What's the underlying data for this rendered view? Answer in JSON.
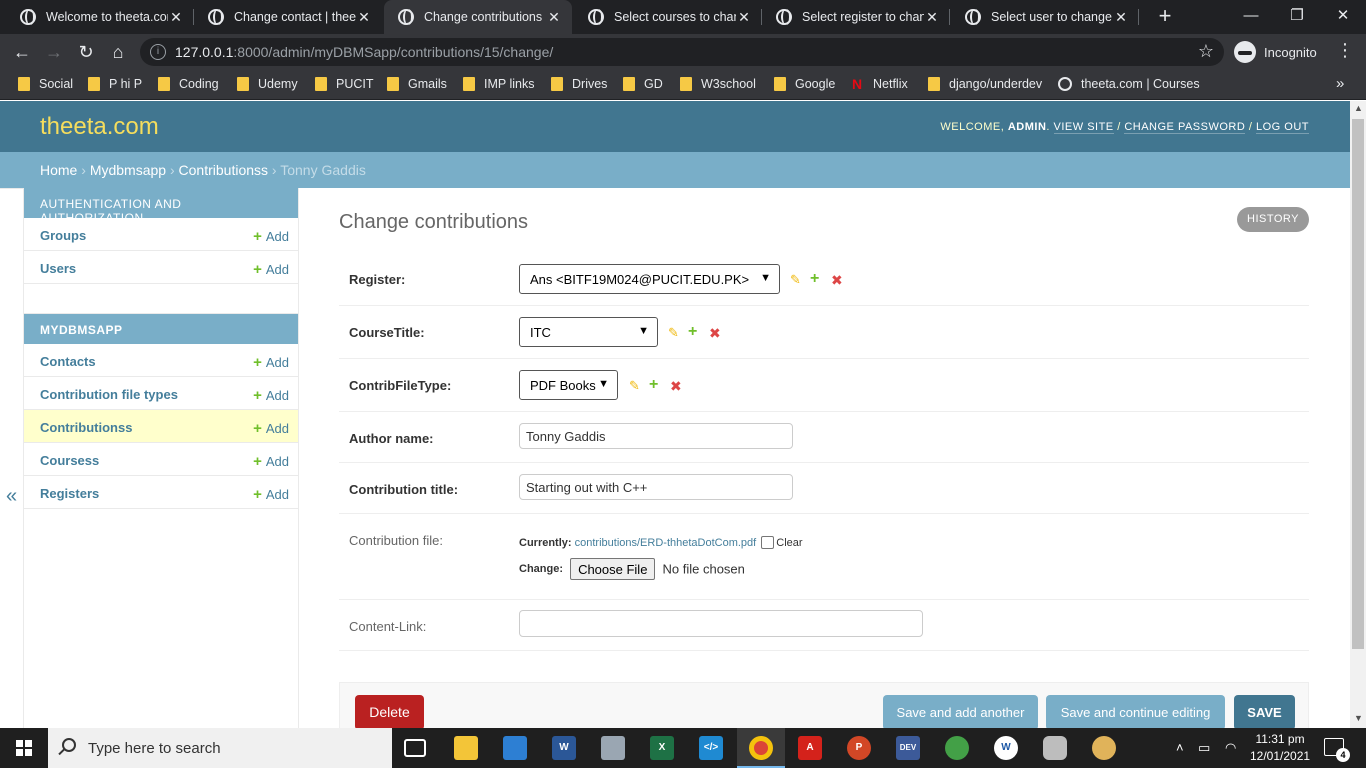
{
  "browser": {
    "tabs": [
      {
        "title": "Welcome to theeta.com"
      },
      {
        "title": "Change contact | theeta.com"
      },
      {
        "title": "Change contributions | theeta.com"
      },
      {
        "title": "Select courses to change"
      },
      {
        "title": "Select register to change"
      },
      {
        "title": "Select user to change | theeta.com"
      }
    ],
    "url_host": "127.0.0.1",
    "url_rest": ":8000/admin/myDBMSapp/contributions/15/change/",
    "profile_label": "Incognito",
    "bookmarks": [
      "Social",
      "P hi P",
      "Coding",
      "Udemy",
      "PUCIT",
      "Gmails",
      "IMP links",
      "Drives",
      "GD",
      "W3school",
      "Google",
      "Netflix",
      "django/underdev",
      "theeta.com | Courses"
    ]
  },
  "header": {
    "brand": "theeta.com",
    "welcome": "WELCOME,",
    "username": "ADMIN",
    "view_site": "VIEW SITE",
    "change_password": "CHANGE PASSWORD",
    "log_out": "LOG OUT"
  },
  "breadcrumbs": {
    "home": "Home",
    "app": "Mydbmsapp",
    "model": "Contributionss",
    "current": "Tonny Gaddis"
  },
  "sidebar": {
    "toggle": "«",
    "add_label": "Add",
    "auth_caption": "AUTHENTICATION AND AUTHORIZATION",
    "auth_items": [
      "Groups",
      "Users"
    ],
    "app_caption": "MYDBMSAPP",
    "app_items": [
      "Contacts",
      "Contribution file types",
      "Contributionss",
      "Coursess",
      "Registers"
    ]
  },
  "content": {
    "title": "Change contributions",
    "history": "HISTORY",
    "fields": {
      "register": {
        "label": "Register:",
        "value": "Ans <BITF19M024@PUCIT.EDU.PK>"
      },
      "course_title": {
        "label": "CourseTitle:",
        "value": "ITC"
      },
      "contrib_file_type": {
        "label": "ContribFileType:",
        "value": "PDF Books"
      },
      "author_name": {
        "label": "Author name:",
        "value": "Tonny Gaddis"
      },
      "contribution_title": {
        "label": "Contribution title:",
        "value": "Starting out with C++"
      },
      "contribution_file": {
        "label": "Contribution file:",
        "currently_label": "Currently:",
        "current_file": "contributions/ERD-thhetaDotCom.pdf",
        "clear_label": "Clear",
        "change_label": "Change:",
        "choose_button": "Choose File",
        "no_file": "No file chosen"
      },
      "content_link": {
        "label": "Content-Link:",
        "value": ""
      }
    },
    "buttons": {
      "delete": "Delete",
      "save_add_another": "Save and add another",
      "save_continue": "Save and continue editing",
      "save": "SAVE"
    }
  },
  "taskbar": {
    "search_placeholder": "Type here to search",
    "time": "11:31 pm",
    "date": "12/01/2021",
    "notification_count": "4",
    "apps": [
      "task-view",
      "file-explorer",
      "news",
      "word",
      "photos",
      "excel",
      "vscode",
      "chrome",
      "acrobat",
      "powerpoint",
      "devcpp",
      "network",
      "wamp",
      "database",
      "paint"
    ]
  },
  "colors": {
    "header_bg": "#417690",
    "breadcrumb_bg": "#79aec8",
    "brand": "#f5dd5d",
    "link": "#447e9b",
    "delete": "#ba2121",
    "add_plus": "#70bf2b",
    "edit_pencil": "#efb80b",
    "delete_x": "#dd4646"
  }
}
